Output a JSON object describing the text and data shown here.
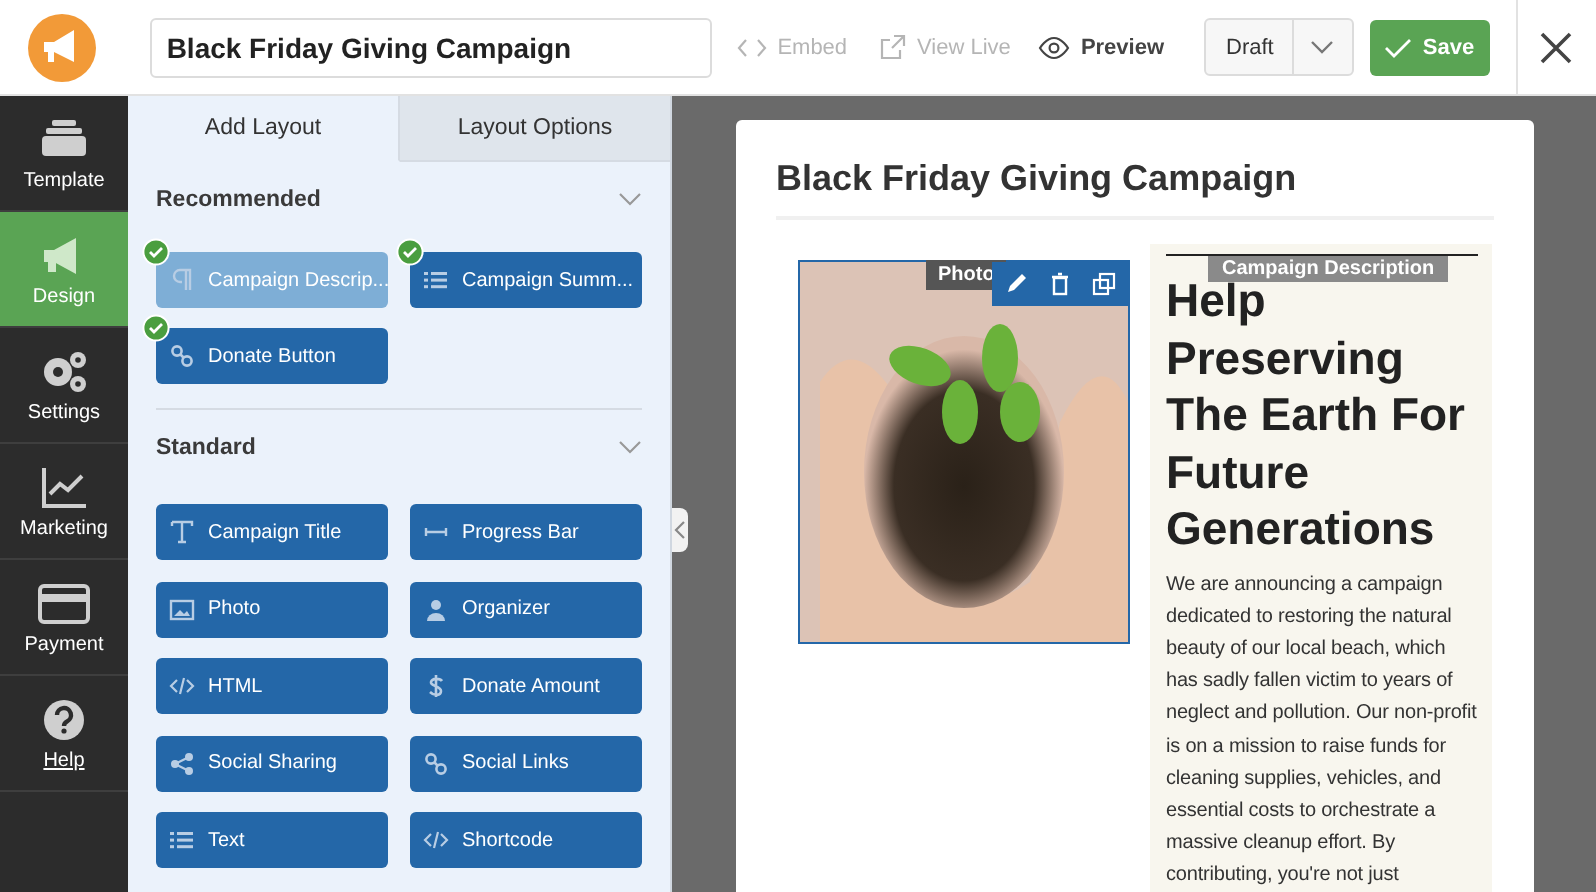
{
  "header": {
    "title_field": "Black Friday Giving Campaign",
    "actions": [
      {
        "kind": "embed",
        "label": "Embed",
        "disabled": true
      },
      {
        "kind": "view",
        "label": "View Live",
        "disabled": true
      },
      {
        "kind": "preview",
        "label": "Preview",
        "disabled": false
      }
    ],
    "status_select": "Draft",
    "save_button": "Save"
  },
  "nav": [
    {
      "kind": "template",
      "label": "Template",
      "selected": false
    },
    {
      "kind": "design",
      "label": "Design",
      "selected": true
    },
    {
      "kind": "settings",
      "label": "Settings",
      "selected": false
    },
    {
      "kind": "marketing",
      "label": "Marketing",
      "selected": false
    },
    {
      "kind": "payment",
      "label": "Payment",
      "selected": false
    },
    {
      "kind": "help",
      "label": "Help",
      "selected": false
    }
  ],
  "panel": {
    "tabs": [
      {
        "label": "Add Layout",
        "selected": true
      },
      {
        "label": "Layout Options",
        "selected": false
      }
    ],
    "sections": [
      {
        "title": "Recommended",
        "expanded": true,
        "items": [
          {
            "kind": "paragraph",
            "label": "Campaign Descrip...",
            "added": true,
            "disabled": true
          },
          {
            "kind": "list",
            "label": "Campaign Summ...",
            "added": true,
            "disabled": false
          },
          {
            "kind": "link",
            "label": "Donate Button",
            "added": true,
            "disabled": false
          }
        ]
      },
      {
        "title": "Standard",
        "expanded": true,
        "items": [
          {
            "kind": "title",
            "label": "Campaign Title",
            "added": false,
            "disabled": false
          },
          {
            "kind": "progress",
            "label": "Progress Bar",
            "added": false,
            "disabled": false
          },
          {
            "kind": "image",
            "label": "Photo",
            "added": false,
            "disabled": false
          },
          {
            "kind": "person",
            "label": "Organizer",
            "added": false,
            "disabled": false
          },
          {
            "kind": "code",
            "label": "HTML",
            "added": false,
            "disabled": false
          },
          {
            "kind": "dollar",
            "label": "Donate Amount",
            "added": false,
            "disabled": false
          },
          {
            "kind": "share",
            "label": "Social Sharing",
            "added": false,
            "disabled": false
          },
          {
            "kind": "link",
            "label": "Social Links",
            "added": false,
            "disabled": false
          },
          {
            "kind": "list",
            "label": "Text",
            "added": false,
            "disabled": false
          },
          {
            "kind": "code",
            "label": "Shortcode",
            "added": false,
            "disabled": false
          }
        ]
      }
    ]
  },
  "preview": {
    "title": "Black Friday Giving Campaign",
    "photo_label": "Photo",
    "description_label": "Campaign Description",
    "heading": "Help Preserving The Earth For Future Generations",
    "body": "We are announcing a campaign dedicated to restoring the natural beauty of our local beach, which has sadly fallen victim to years of neglect and pollution. Our non-profit is on a mission to raise funds for cleaning supplies, vehicles, and essential costs to orchestrate a massive cleanup effort. By contributing, you're not just"
  }
}
